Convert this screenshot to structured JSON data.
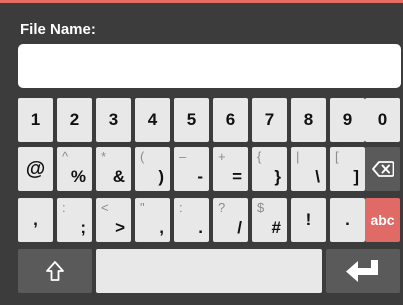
{
  "file_name": {
    "label": "File Name:",
    "value": "",
    "placeholder": ""
  },
  "rows": {
    "numbers": [
      "1",
      "2",
      "3",
      "4",
      "5",
      "6",
      "7",
      "8",
      "9",
      "0"
    ],
    "symbols": [
      {
        "pri": "@",
        "sec": ""
      },
      {
        "pri": "%",
        "sec": "^"
      },
      {
        "pri": "&",
        "sec": "*"
      },
      {
        "pri": ")",
        "sec": "("
      },
      {
        "pri": "-",
        "sec": "–"
      },
      {
        "pri": "=",
        "sec": "+"
      },
      {
        "pri": "}",
        "sec": "{"
      },
      {
        "pri": "\\",
        "sec": "|"
      },
      {
        "pri": "]",
        "sec": "["
      }
    ],
    "punct": [
      {
        "pri": ",",
        "sec": ""
      },
      {
        "pri": ";",
        "sec": ":"
      },
      {
        "pri": ">",
        "sec": "<"
      },
      {
        "pri": ",",
        "sec": "\""
      },
      {
        "pri": ".",
        "sec": ":"
      },
      {
        "pri": "/",
        "sec": "?"
      },
      {
        "pri": "#",
        "sec": "$"
      },
      {
        "pri": "!",
        "sec": ""
      },
      {
        "pri": ".",
        "sec": ""
      }
    ]
  },
  "abc_label": "abc",
  "icons": {
    "backspace": "backspace-icon",
    "shift": "shift-icon",
    "enter": "enter-icon"
  },
  "colors": {
    "accent": "#e06a66",
    "panel": "#3c3c3c",
    "key": "#e8e8e8",
    "dark_key": "#5a5a5a"
  }
}
